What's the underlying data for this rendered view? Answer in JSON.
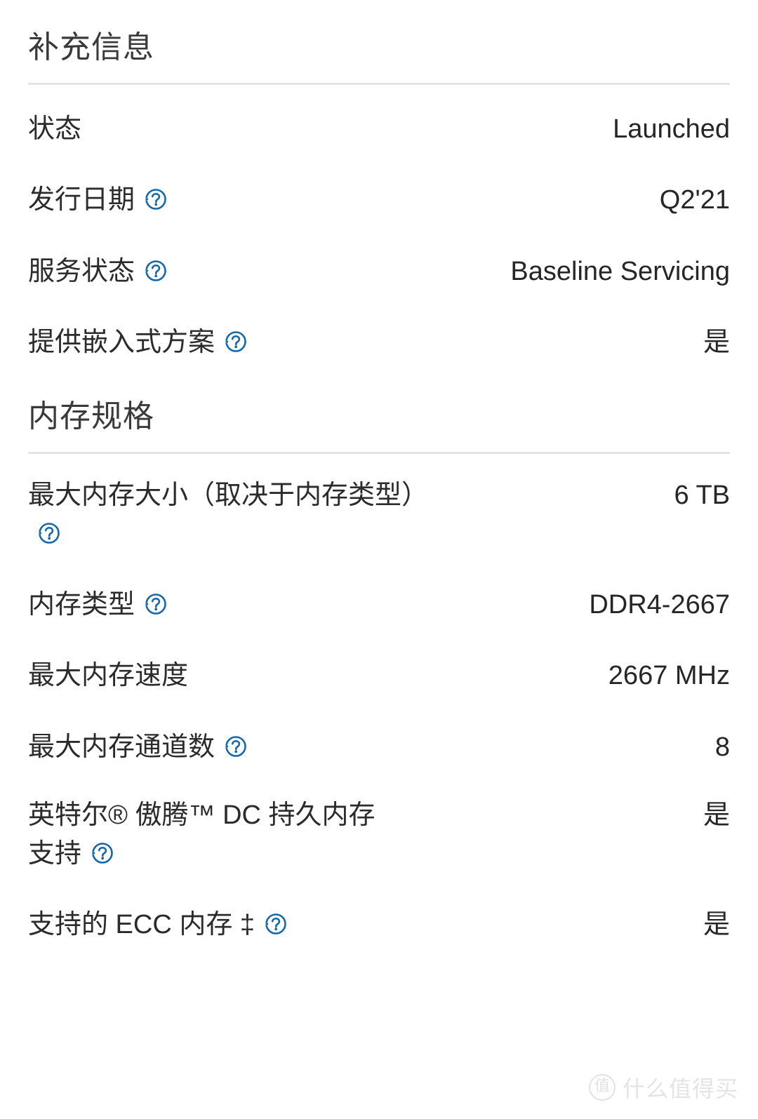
{
  "colors": {
    "background": "#ffffff",
    "label_text": "#2b2b2b",
    "value_text": "#262626",
    "header_text": "#3a3a3a",
    "divider": "#e4e4e4",
    "help_icon_blue": "#1668a8",
    "watermark": "#e4e4e4"
  },
  "sections": [
    {
      "title": "补充信息",
      "rows": [
        {
          "label": "状态",
          "has_help_icon": false,
          "value": "Launched"
        },
        {
          "label": "发行日期",
          "has_help_icon": true,
          "value": "Q2'21"
        },
        {
          "label": "服务状态",
          "has_help_icon": true,
          "value": "Baseline Servicing"
        },
        {
          "label": "提供嵌入式方案",
          "has_help_icon": true,
          "value": "是"
        }
      ]
    },
    {
      "title": "内存规格",
      "rows": [
        {
          "label": "最大内存大小（取决于内存类型）",
          "has_help_icon": true,
          "value": "6 TB"
        },
        {
          "label": "内存类型",
          "has_help_icon": true,
          "value": "DDR4-2667"
        },
        {
          "label": "最大内存速度",
          "has_help_icon": false,
          "value": "2667 MHz"
        },
        {
          "label": "最大内存通道数",
          "has_help_icon": true,
          "value": "8"
        },
        {
          "label": "英特尔® 傲腾™ DC 持久内存支持",
          "has_help_icon": true,
          "value": "是"
        },
        {
          "label": "支持的 ECC 内存 ‡",
          "has_help_icon": true,
          "value": "是"
        }
      ]
    }
  ],
  "help_icon": {
    "name": "help-circle-icon",
    "glyph": "?"
  },
  "watermark": {
    "logo_glyph": "值",
    "text": "什么值得买"
  }
}
